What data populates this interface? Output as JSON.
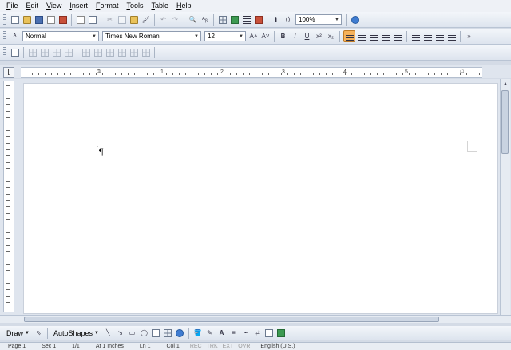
{
  "menus": [
    "File",
    "Edit",
    "View",
    "Insert",
    "Format",
    "Tools",
    "Table",
    "Help"
  ],
  "toolbar": {
    "zoom": "100%"
  },
  "format": {
    "style": "Normal",
    "font": "Times New Roman",
    "size": "12",
    "bold": "B",
    "italic": "I",
    "underline": "U"
  },
  "ruler": {
    "numbers": [
      "1",
      "1",
      "2",
      "3",
      "4",
      "5"
    ]
  },
  "document": {
    "paragraph_mark": "¶"
  },
  "drawing": {
    "draw_label": "Draw",
    "autoshapes_label": "AutoShapes",
    "font_color_glyph": "A"
  },
  "status": [
    "Page 1",
    "Sec 1",
    "1/1",
    "At 1 Inches",
    "Ln 1",
    "Col 1",
    "REC",
    "TRK",
    "EXT",
    "OVR",
    "English (U.S.)"
  ]
}
